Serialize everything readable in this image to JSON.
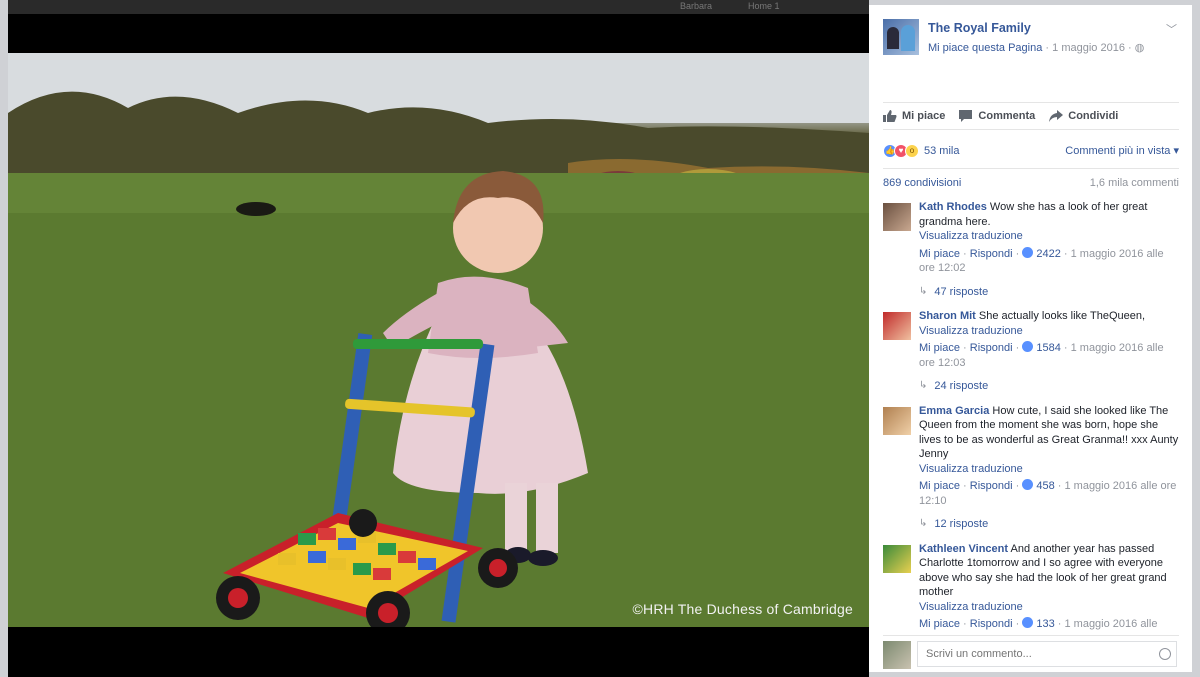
{
  "topbar": {
    "ghost_left": "Barbara",
    "ghost_right": "Home 1"
  },
  "photo": {
    "watermark": "©HRH The Duchess of Cambridge"
  },
  "post": {
    "page_name": "The Royal Family",
    "like_page": "Mi piace questa Pagina",
    "date": "1 maggio 2016",
    "separator": "·"
  },
  "actions": {
    "like": "Mi piace",
    "comment": "Commenta",
    "share": "Condividi"
  },
  "reactions": {
    "count": "53 mila",
    "sort": "Commenti più in vista"
  },
  "stats": {
    "shares": "869 condivisioni",
    "comments": "1,6 mila commenti"
  },
  "comments": [
    {
      "author": "Kath Rhodes",
      "text": "Wow she has a look of her great grandma here.",
      "translate": "Visualizza traduzione",
      "like": "Mi piace",
      "reply": "Rispondi",
      "likes": "2422",
      "time": "1 maggio 2016 alle ore 12:02",
      "replies": "47 risposte"
    },
    {
      "author": "Sharon Mit",
      "text": "She actually looks like TheQueen,",
      "translate": "Visualizza traduzione",
      "like": "Mi piace",
      "reply": "Rispondi",
      "likes": "1584",
      "time": "1 maggio 2016 alle ore 12:03",
      "replies": "24 risposte"
    },
    {
      "author": "Emma Garcia",
      "text": "How cute, I said she looked like The Queen from the moment she was born, hope she lives to be as wonderful as Great Granma!! xxx Aunty Jenny",
      "translate": "Visualizza traduzione",
      "like": "Mi piace",
      "reply": "Rispondi",
      "likes": "458",
      "time": "1 maggio 2016 alle ore 12:10",
      "replies": "12 risposte"
    },
    {
      "author": "Kathleen Vincent",
      "text": "And another year has passed Charlotte 1tomorrow and I so agree with everyone above who say she had the look of her great grand mother",
      "translate": "Visualizza traduzione",
      "like": "Mi piace",
      "reply": "Rispondi",
      "likes": "133",
      "time": "1 maggio 2016 alle",
      "replies": ""
    }
  ],
  "write": {
    "placeholder": "Scrivi un commento..."
  },
  "colors": {
    "link": "#365899",
    "meta": "#90949c",
    "like_blue": "#5890ff"
  }
}
